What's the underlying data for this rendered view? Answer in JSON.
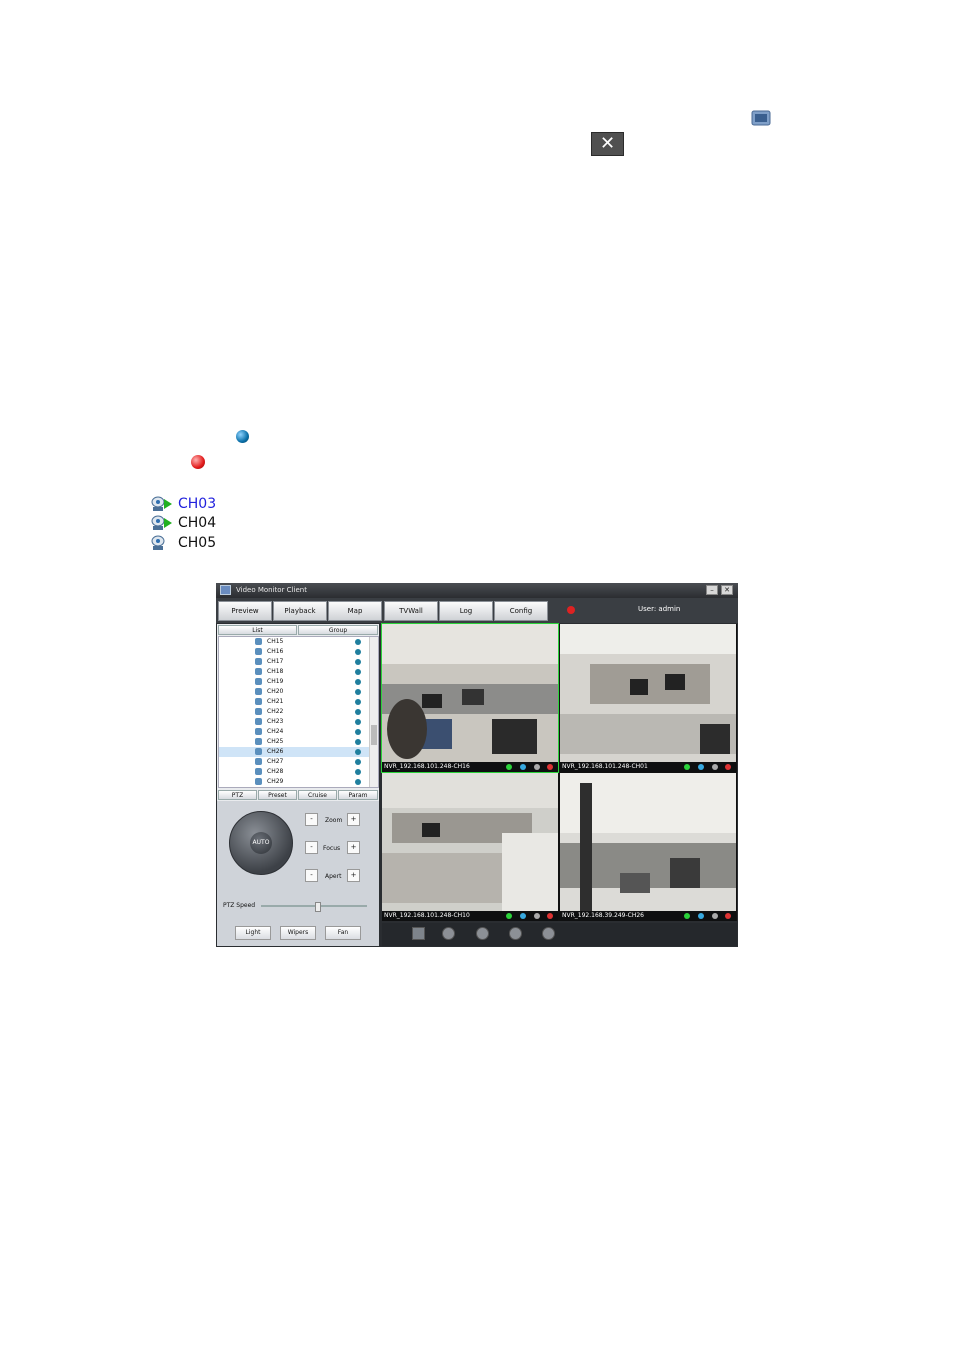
{
  "doc": {
    "channels": [
      {
        "label": "CH03",
        "color": "#2222dd"
      },
      {
        "label": "CH04",
        "color": "#111111"
      },
      {
        "label": "CH05",
        "color": "#111111"
      }
    ]
  },
  "app": {
    "title": "Video Monitor Client",
    "nav": [
      "Preview",
      "Playback",
      "Map",
      "TVWall",
      "Log",
      "Config"
    ],
    "user_label": "User: admin",
    "panel_tabs": [
      "List",
      "Group"
    ],
    "channel_list": [
      "CH15",
      "CH16",
      "CH17",
      "CH18",
      "CH19",
      "CH20",
      "CH21",
      "CH22",
      "CH23",
      "CH24",
      "CH25",
      "CH26",
      "CH27",
      "CH28",
      "CH29"
    ],
    "selected_channel": "CH26",
    "ptz_tabs": [
      "PTZ",
      "Preset",
      "Cruise",
      "Param"
    ],
    "joystick_label": "AUTO",
    "zoom_label": "Zoom",
    "focus_label": "Focus",
    "apert_label": "Apert",
    "ptz_speed_label": "PTZ Speed",
    "ptz_buttons": [
      "Light",
      "Wipers",
      "Fan"
    ],
    "video_cells": [
      {
        "label": "NVR_192.168.101.248-CH16"
      },
      {
        "label": "NVR_192.168.101.248-CH01"
      },
      {
        "label": "NVR_192.168.101.248-CH10"
      },
      {
        "label": "NVR_192.168.39.249-CH26"
      }
    ],
    "accent_active": "#2bd23a"
  }
}
